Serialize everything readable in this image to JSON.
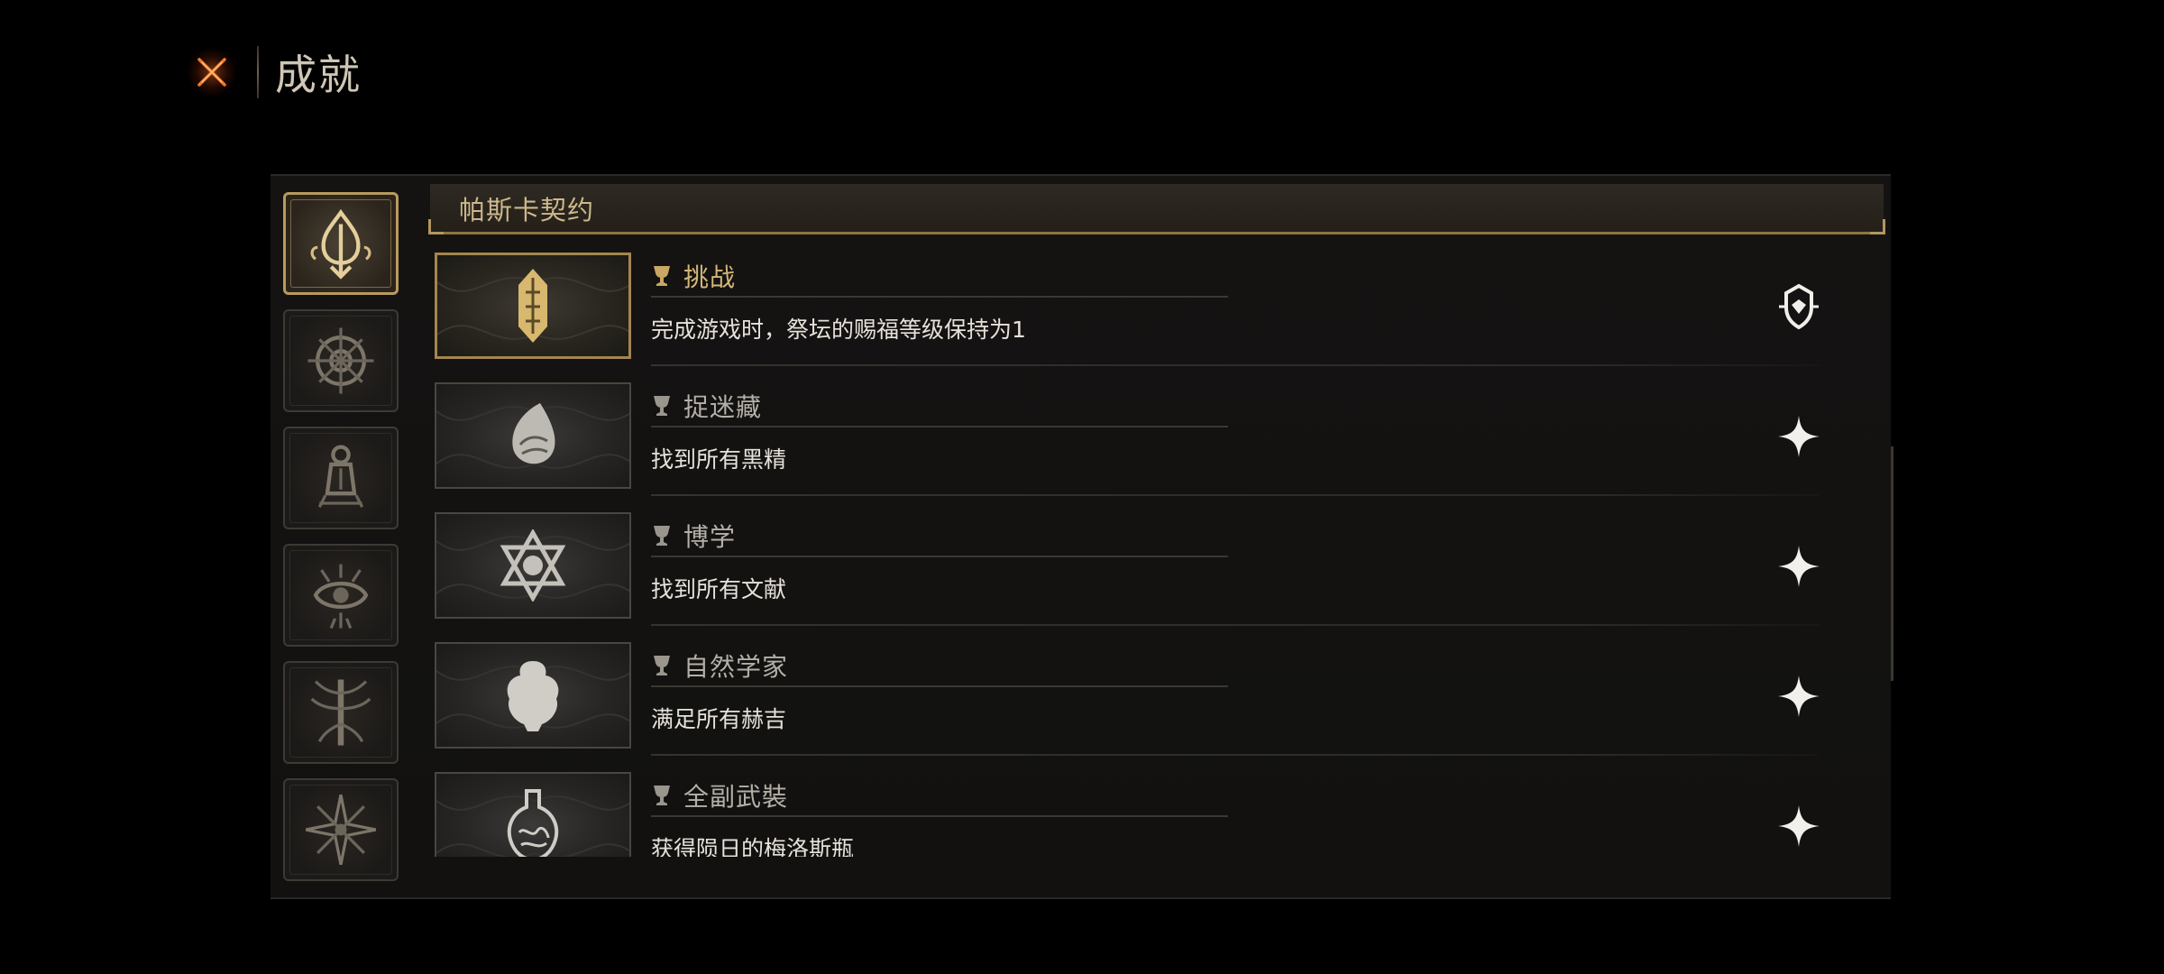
{
  "header": {
    "close_icon": "close-x-icon",
    "title": "成就"
  },
  "categories": [
    {
      "icon": "tentacle-sigil-icon",
      "active": true
    },
    {
      "icon": "compass-wheel-sigil-icon",
      "active": false
    },
    {
      "icon": "lantern-sigil-icon",
      "active": false
    },
    {
      "icon": "eye-sigil-icon",
      "active": false
    },
    {
      "icon": "tree-sigil-icon",
      "active": false
    },
    {
      "icon": "sun-sigil-icon",
      "active": false
    }
  ],
  "category_header": {
    "title": "帕斯卡契约"
  },
  "achievements": [
    {
      "name": "挑战",
      "desc": "完成游戏时，祭坛的赐福等级保持为1",
      "completed": true,
      "thumb_icon": "rune-emblem-icon",
      "state_icon": "completed-emblem-icon"
    },
    {
      "name": "捉迷藏",
      "desc": "找到所有黑精",
      "completed": false,
      "thumb_icon": "seed-emblem-icon",
      "state_icon": "sparkle-icon"
    },
    {
      "name": "博学",
      "desc": "找到所有文献",
      "completed": false,
      "thumb_icon": "hexagram-emblem-icon",
      "state_icon": "sparkle-icon"
    },
    {
      "name": "自然学家",
      "desc": "满足所有赫吉",
      "completed": false,
      "thumb_icon": "beast-emblem-icon",
      "state_icon": "sparkle-icon"
    },
    {
      "name": "全副武裝",
      "desc": "获得陨日的梅洛斯瓶",
      "completed": false,
      "thumb_icon": "flask-emblem-icon",
      "state_icon": "sparkle-icon"
    }
  ],
  "colors": {
    "accent_gold": "#b89a5c",
    "background": "#000000",
    "panel": "#141312",
    "close_orange": "#e8651e"
  }
}
